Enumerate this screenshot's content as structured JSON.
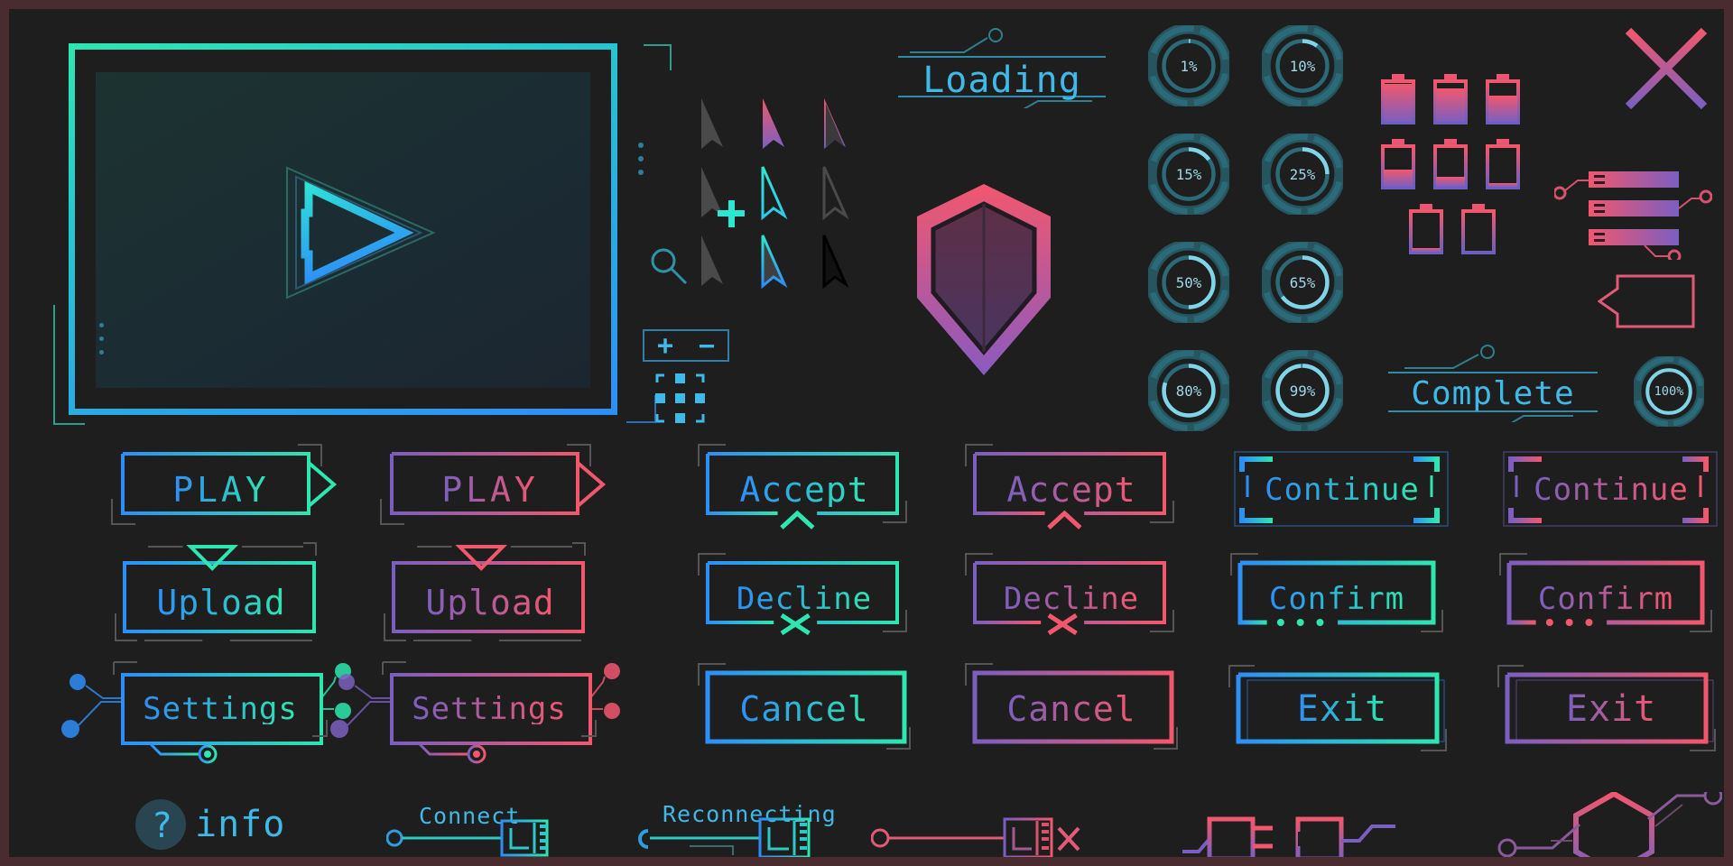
{
  "theme": {
    "background": "#1e1e1e",
    "outer_border": "#4a2b30",
    "accent_cyan_start": "#2e8ef7",
    "accent_cyan_end": "#2ee6b0",
    "accent_pink_start": "#7b5fc0",
    "accent_pink_end": "#f2576e",
    "text_blue": "#3fa9f5"
  },
  "preview_panel": {
    "name": "video-preview-frame",
    "play_icon": "play-triangle-icon"
  },
  "cursors": {
    "title": "cursor-set",
    "items": [
      "cursor-grey-solid",
      "cursor-pink-outline",
      "cursor-pink-grey",
      "cursor-grey-solid-2",
      "cursor-cyan-outline",
      "cursor-faint-outline",
      "cursor-grey-solid-3",
      "cursor-blue-outline",
      "cursor-black-outline"
    ]
  },
  "tools": {
    "search_icon": "magnifier-icon",
    "plus_icon": "plus-icon",
    "zoom_plus": "+",
    "zoom_minus": "−",
    "grid_icon": "dot-grid-icon"
  },
  "status": {
    "loading_label": "Loading",
    "complete_label": "Complete"
  },
  "shield": {
    "name": "shield-badge"
  },
  "close": {
    "name": "close-x-icon"
  },
  "progress_rings": [
    {
      "label": "1%",
      "value": 1
    },
    {
      "label": "10%",
      "value": 10
    },
    {
      "label": "15%",
      "value": 15
    },
    {
      "label": "25%",
      "value": 25
    },
    {
      "label": "50%",
      "value": 50
    },
    {
      "label": "65%",
      "value": 65
    },
    {
      "label": "80%",
      "value": 80
    },
    {
      "label": "99%",
      "value": 99
    },
    {
      "label": "100%",
      "value": 100
    }
  ],
  "batteries": [
    {
      "name": "battery-full",
      "level": 100
    },
    {
      "name": "battery-90",
      "level": 88
    },
    {
      "name": "battery-70",
      "level": 68
    },
    {
      "name": "battery-45",
      "level": 45
    },
    {
      "name": "battery-25",
      "level": 25
    },
    {
      "name": "battery-10",
      "level": 10
    },
    {
      "name": "battery-low",
      "level": 5
    },
    {
      "name": "battery-empty",
      "level": 0
    }
  ],
  "buttons": {
    "rows": [
      [
        {
          "label": "PLAY",
          "variant": "cyan",
          "style": "play"
        },
        {
          "label": "PLAY",
          "variant": "pink",
          "style": "play"
        },
        {
          "label": "Accept",
          "variant": "cyan",
          "style": "accept"
        },
        {
          "label": "Accept",
          "variant": "pink",
          "style": "accept"
        },
        {
          "label": "Continue",
          "variant": "cyan",
          "style": "continue"
        },
        {
          "label": "Continue",
          "variant": "pink",
          "style": "continue"
        }
      ],
      [
        {
          "label": "Upload",
          "variant": "cyan",
          "style": "upload"
        },
        {
          "label": "Upload",
          "variant": "pink",
          "style": "upload"
        },
        {
          "label": "Decline",
          "variant": "cyan",
          "style": "decline"
        },
        {
          "label": "Decline",
          "variant": "pink",
          "style": "decline"
        },
        {
          "label": "Confirm",
          "variant": "cyan",
          "style": "confirm"
        },
        {
          "label": "Confirm",
          "variant": "pink",
          "style": "confirm"
        }
      ],
      [
        {
          "label": "Settings",
          "variant": "cyan",
          "style": "settings"
        },
        {
          "label": "Settings",
          "variant": "pink",
          "style": "settings"
        },
        {
          "label": "Cancel",
          "variant": "cyan",
          "style": "cancel"
        },
        {
          "label": "Cancel",
          "variant": "pink",
          "style": "cancel"
        },
        {
          "label": "Exit",
          "variant": "cyan",
          "style": "exit"
        },
        {
          "label": "Exit",
          "variant": "pink",
          "style": "exit"
        }
      ]
    ]
  },
  "footer": {
    "info_label": "info",
    "info_icon": "question-mark-icon",
    "connect_label": "Connect",
    "reconnecting_label": "Reconnecting",
    "disconnect_icon": "plug-disconnected-icon",
    "plug_icon": "plug-icon",
    "socket_icon": "socket-icon",
    "hex_node_icon": "hex-node-icon"
  }
}
